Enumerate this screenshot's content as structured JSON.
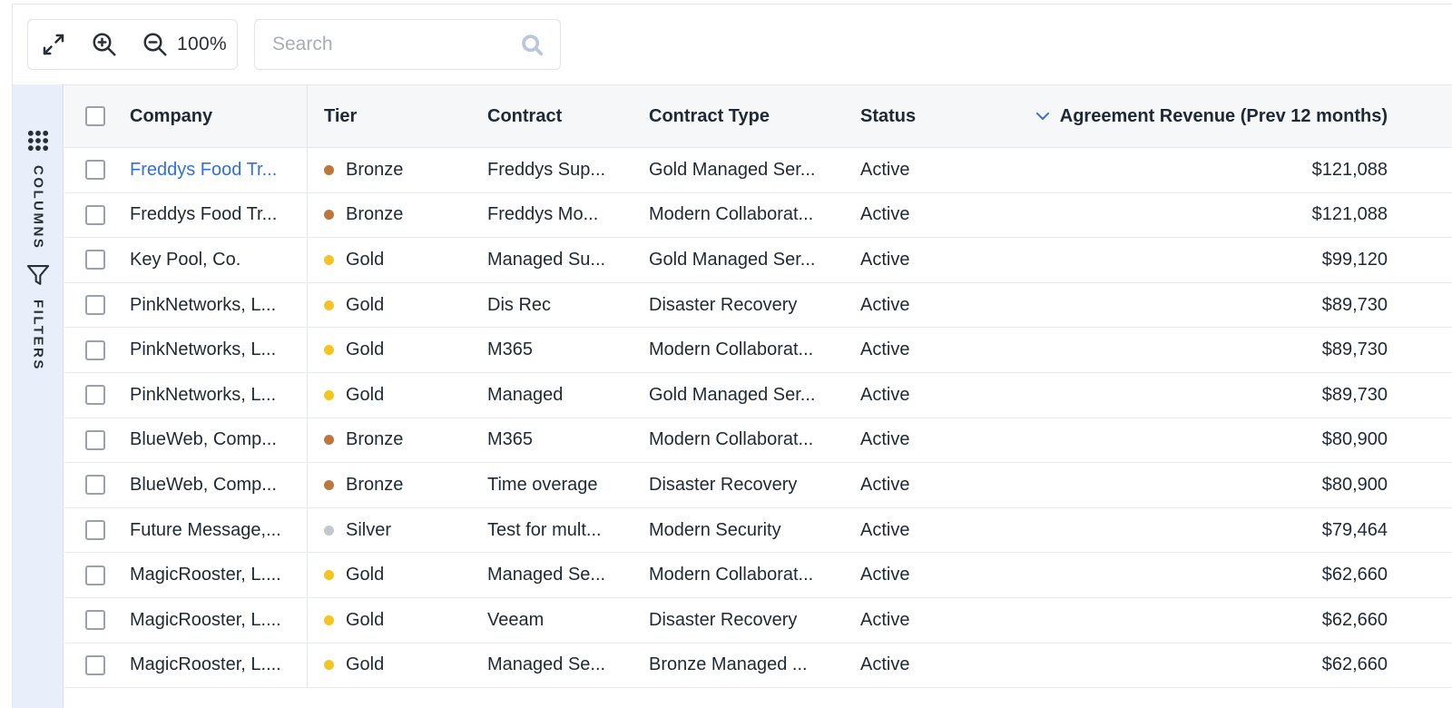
{
  "toolbar": {
    "zoom_level": "100%",
    "search_placeholder": "Search"
  },
  "sidepanel": {
    "columns_label": "COLUMNS",
    "filters_label": "FILTERS"
  },
  "columns": {
    "company": "Company",
    "tier": "Tier",
    "contract": "Contract",
    "contract_type": "Contract Type",
    "status": "Status",
    "revenue": "Agreement Revenue (Prev 12 months)"
  },
  "colors": {
    "bronze": "#c0763a",
    "gold": "#f4c520",
    "silver": "#c4c7cb",
    "link": "#2f6fe0",
    "sidepanel": "#e9eefb"
  },
  "rows": [
    {
      "company": "Freddys Food Tr...",
      "tier": "Bronze",
      "contract": "Freddys Sup...",
      "contract_type": "Gold Managed Ser...",
      "status": "Active",
      "revenue": "$121,088"
    },
    {
      "company": "Freddys Food Tr...",
      "tier": "Bronze",
      "contract": "Freddys Mo...",
      "contract_type": "Modern Collaborat...",
      "status": "Active",
      "revenue": "$121,088"
    },
    {
      "company": "Key Pool, Co.",
      "tier": "Gold",
      "contract": "Managed Su...",
      "contract_type": "Gold Managed Ser...",
      "status": "Active",
      "revenue": "$99,120"
    },
    {
      "company": "PinkNetworks, L...",
      "tier": "Gold",
      "contract": "Dis Rec",
      "contract_type": "Disaster Recovery",
      "status": "Active",
      "revenue": "$89,730"
    },
    {
      "company": "PinkNetworks, L...",
      "tier": "Gold",
      "contract": "M365",
      "contract_type": "Modern Collaborat...",
      "status": "Active",
      "revenue": "$89,730"
    },
    {
      "company": "PinkNetworks, L...",
      "tier": "Gold",
      "contract": "Managed",
      "contract_type": "Gold Managed Ser...",
      "status": "Active",
      "revenue": "$89,730"
    },
    {
      "company": "BlueWeb, Comp...",
      "tier": "Bronze",
      "contract": "M365",
      "contract_type": "Modern Collaborat...",
      "status": "Active",
      "revenue": "$80,900"
    },
    {
      "company": "BlueWeb, Comp...",
      "tier": "Bronze",
      "contract": "Time overage",
      "contract_type": "Disaster Recovery",
      "status": "Active",
      "revenue": "$80,900"
    },
    {
      "company": "Future Message,...",
      "tier": "Silver",
      "contract": "Test for mult...",
      "contract_type": "Modern Security",
      "status": "Active",
      "revenue": "$79,464"
    },
    {
      "company": "MagicRooster, L....",
      "tier": "Gold",
      "contract": "Managed Se...",
      "contract_type": "Modern Collaborat...",
      "status": "Active",
      "revenue": "$62,660"
    },
    {
      "company": "MagicRooster, L....",
      "tier": "Gold",
      "contract": "Veeam",
      "contract_type": "Disaster Recovery",
      "status": "Active",
      "revenue": "$62,660"
    },
    {
      "company": "MagicRooster, L....",
      "tier": "Gold",
      "contract": "Managed Se...",
      "contract_type": "Bronze Managed ...",
      "status": "Active",
      "revenue": "$62,660"
    }
  ]
}
